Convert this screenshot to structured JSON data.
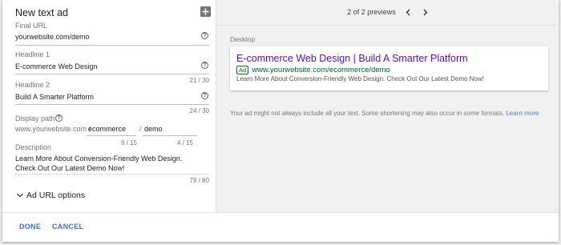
{
  "form": {
    "title": "New text ad",
    "final_url": {
      "label": "Final URL",
      "value": "yourwebsite.com/demo"
    },
    "headline1": {
      "label": "Headline 1",
      "value": "E-commerce Web Design",
      "counter": "21 / 30"
    },
    "headline2": {
      "label": "Headline 2",
      "value": "Build A Smarter Platform",
      "counter": "24 / 30"
    },
    "display_path": {
      "label": "Display path",
      "base": "www.yourwebsite.com /",
      "path1": "ecommerce",
      "sep": "/",
      "path2": "demo",
      "counter1": "9 / 15",
      "counter2": "4 / 15"
    },
    "description": {
      "label": "Description",
      "value": "Learn More About Conversion-Friendly Web Design. Check Out Our Latest Demo Now!",
      "counter": "79 / 80"
    },
    "ad_url_options": "Ad URL options"
  },
  "preview": {
    "nav_text": "2 of 2 previews",
    "device_label": "Desktop",
    "ad": {
      "headline": "E-commerce Web Design | Build A Smarter Platform",
      "badge": "Ad",
      "display_url": "www.yourwebsite.com/ecommerce/demo",
      "description": "Learn More About Conversion-Friendly Web Design. Check Out Our Latest Demo Now!"
    },
    "disclaimer": "Your ad might not always include all your text. Some shortening may also occur in some formats.",
    "learn_more": "Learn more"
  },
  "footer": {
    "done": "DONE",
    "cancel": "CANCEL"
  },
  "icons": {
    "add": "add-box-icon",
    "help": "help-circle-icon",
    "chevron": "chevron-down-icon",
    "prev": "chevron-left-icon",
    "next": "chevron-right-icon"
  }
}
